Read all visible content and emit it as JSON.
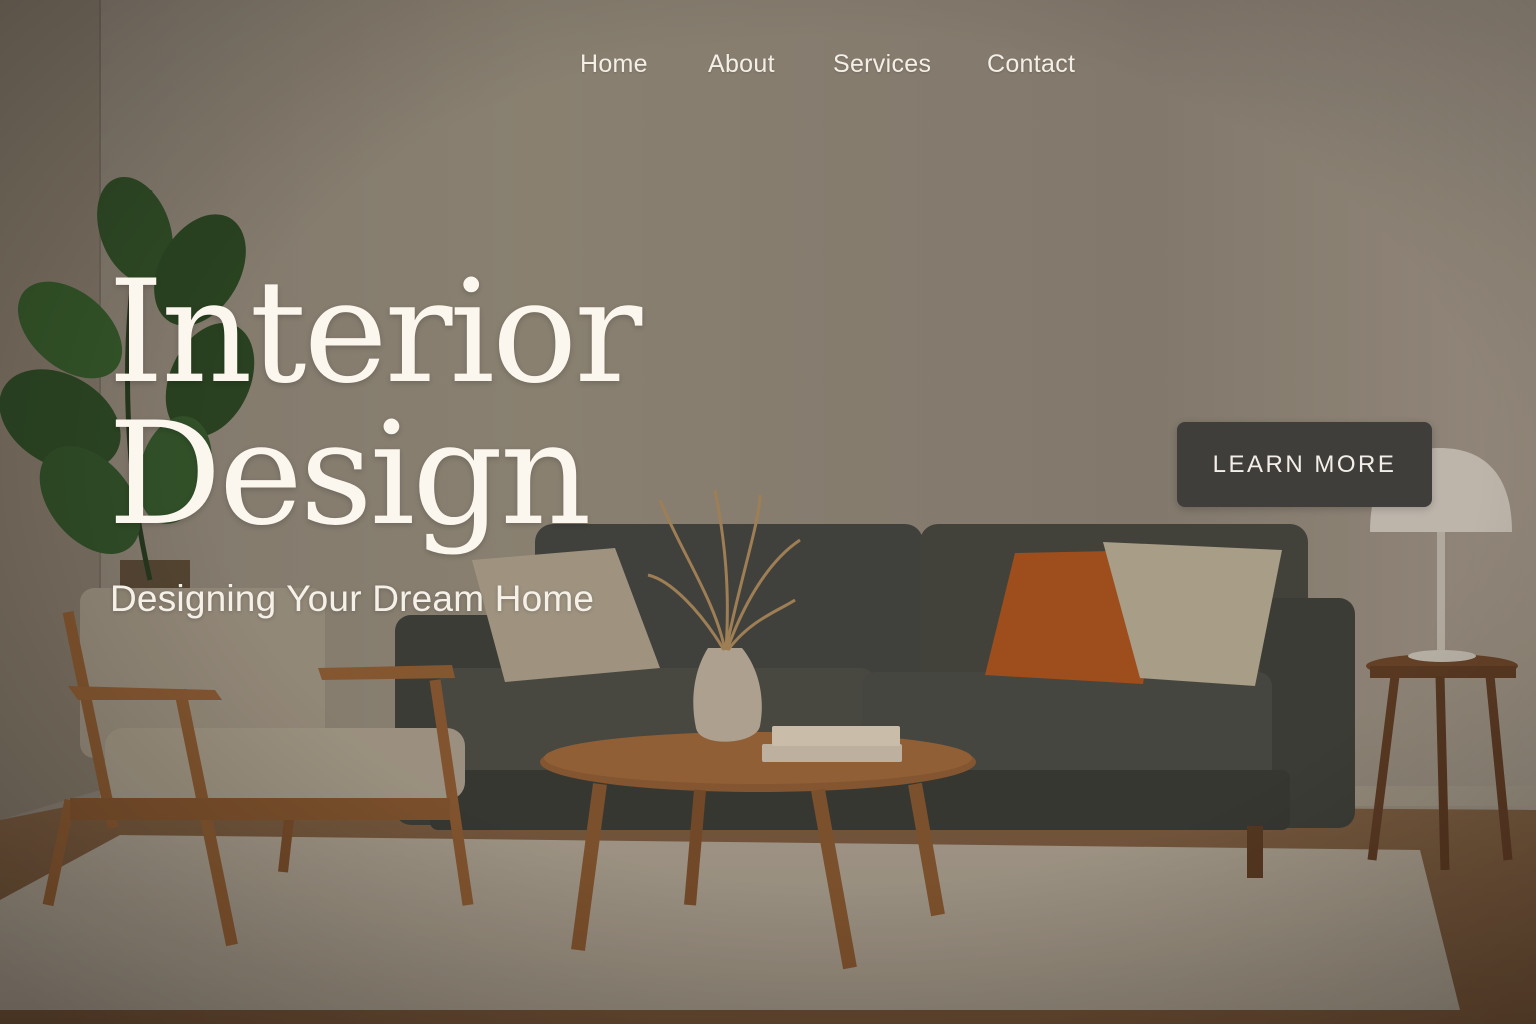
{
  "nav": {
    "items": [
      {
        "label": "Home"
      },
      {
        "label": "About"
      },
      {
        "label": "Services"
      },
      {
        "label": "Contact"
      }
    ]
  },
  "hero": {
    "title_line1": "Interior",
    "title_line2": "Design",
    "subtitle": "Designing Your Dream Home",
    "cta_label": "LEARN MORE"
  },
  "colors": {
    "wall": "#8c8276",
    "sofa": "#454540",
    "wood": "#8a5a32",
    "accent_pillow": "#a8531f",
    "cta_bg": "#3f3e3b",
    "text_light": "#fbf6ee"
  },
  "scene_objects": [
    "plant",
    "armchair",
    "sofa",
    "pillows",
    "coffee-table",
    "vase",
    "pampas-grass",
    "books",
    "side-table",
    "lamp",
    "rug"
  ]
}
